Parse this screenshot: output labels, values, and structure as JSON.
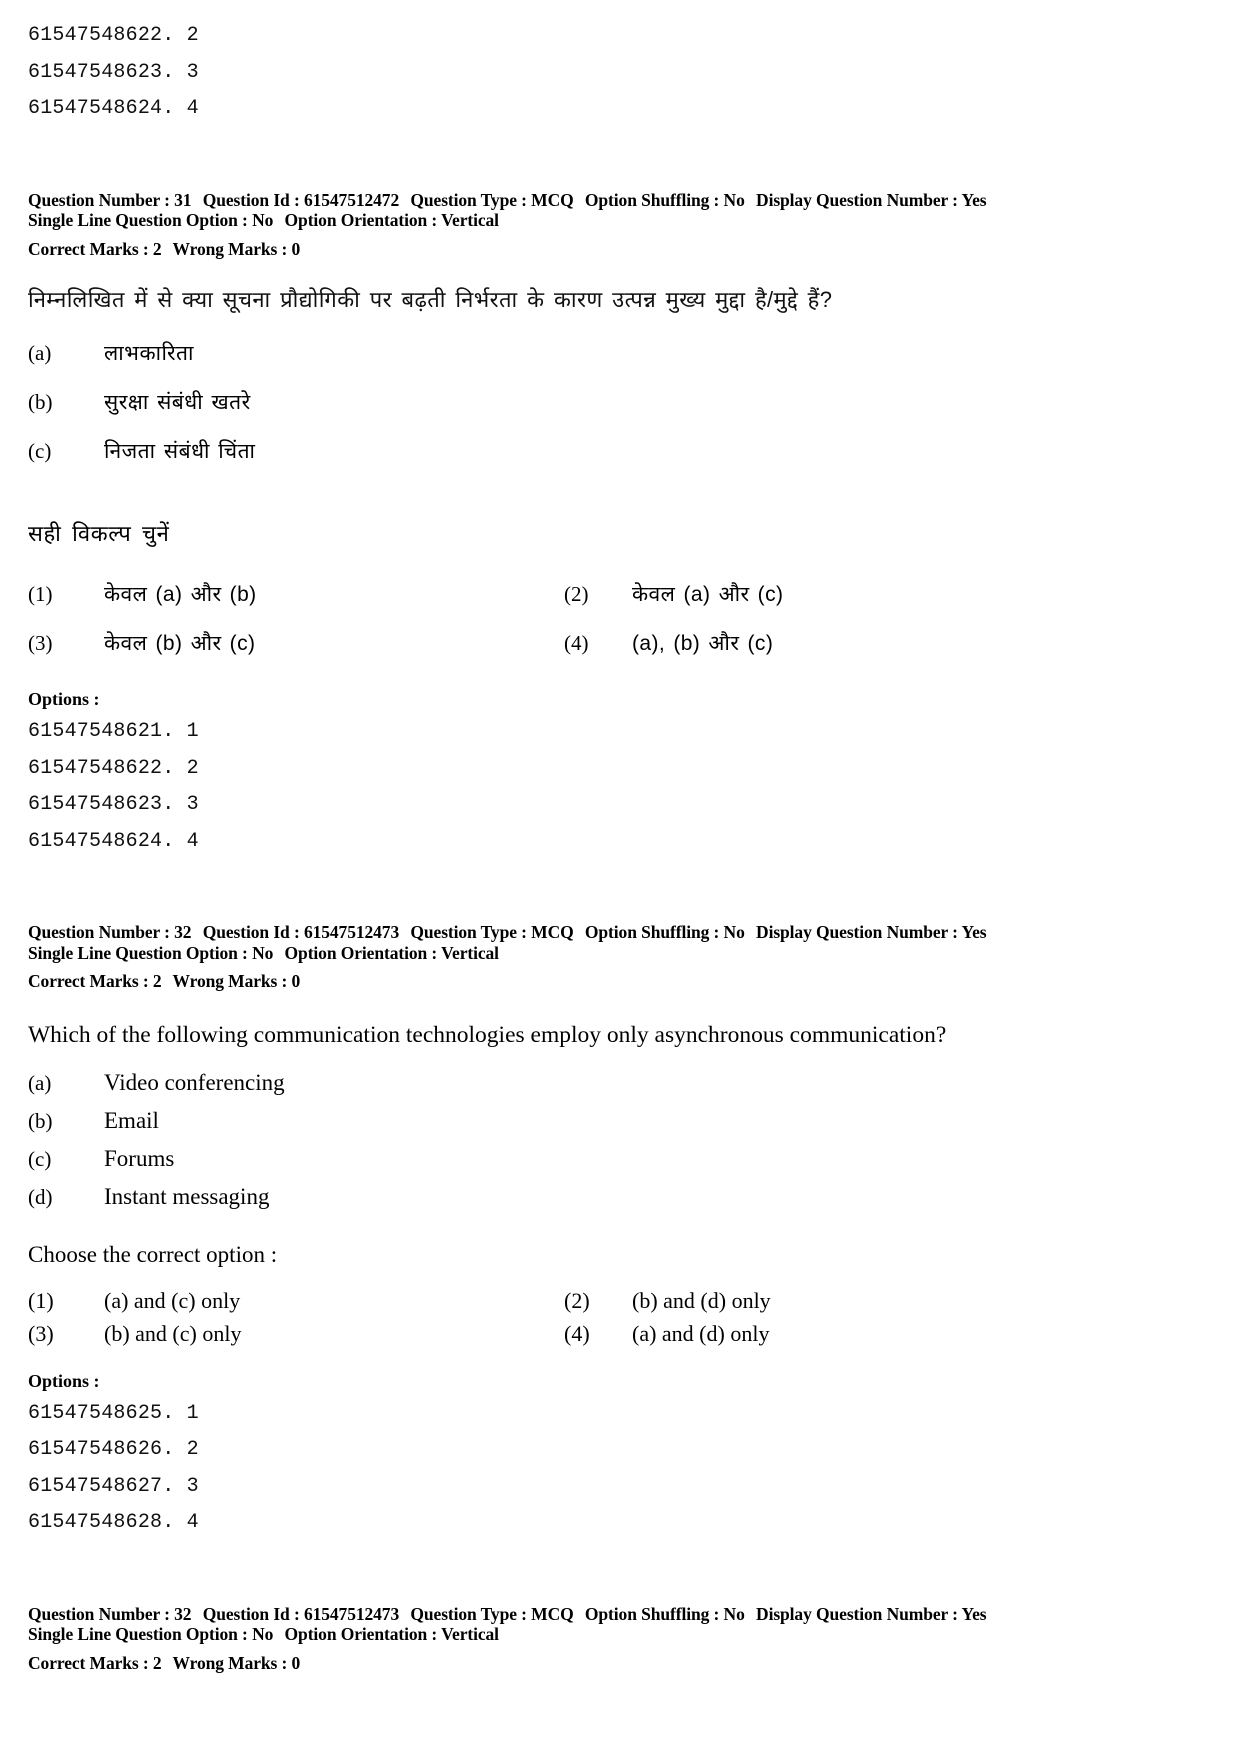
{
  "page": {
    "top_option_ids": [
      "61547548622. 2",
      "61547548623. 3",
      "61547548624. 4"
    ]
  },
  "question_31": {
    "meta": {
      "question_number_label": "Question Number :",
      "question_number": "31",
      "question_id_label": "Question Id :",
      "question_id": "61547512472",
      "question_type_label": "Question Type :",
      "question_type": "MCQ",
      "option_shuffling_label": "Option Shuffling :",
      "option_shuffling": "No",
      "display_question_number_label": "Display Question Number :",
      "display_question_number": "Yes",
      "single_line_question_option_label": "Single Line Question Option :",
      "single_line_question_option": "No",
      "option_orientation_label": "Option Orientation :",
      "option_orientation": "Vertical",
      "correct_marks_label": "Correct Marks :",
      "correct_marks": "2",
      "wrong_marks_label": "Wrong Marks :",
      "wrong_marks": "0"
    },
    "stem": "निम्नलिखित में से क्या सूचना प्रौद्योगिकी पर बढ़ती निर्भरता के कारण उत्पन्न मुख्य मुद्दा है/मुद्दे हैं?",
    "sub_options": [
      {
        "label": "(a)",
        "text": "लाभकारिता"
      },
      {
        "label": "(b)",
        "text": "सुरक्षा संबंधी खतरे"
      },
      {
        "label": "(c)",
        "text": "निजता संबंधी चिंता"
      }
    ],
    "choose_instruction": "सही विकल्प चुनें",
    "choices": [
      {
        "num": "(1)",
        "text": "केवल (a) और (b)"
      },
      {
        "num": "(2)",
        "text": "केवल (a) और (c)"
      },
      {
        "num": "(3)",
        "text": "केवल (b) और (c)"
      },
      {
        "num": "(4)",
        "text": "(a), (b) और (c)"
      }
    ],
    "options_label": "Options :",
    "option_ids": [
      "61547548621. 1",
      "61547548622. 2",
      "61547548623. 3",
      "61547548624. 4"
    ]
  },
  "question_32": {
    "meta": {
      "question_number_label": "Question Number :",
      "question_number": "32",
      "question_id_label": "Question Id :",
      "question_id": "61547512473",
      "question_type_label": "Question Type :",
      "question_type": "MCQ",
      "option_shuffling_label": "Option Shuffling :",
      "option_shuffling": "No",
      "display_question_number_label": "Display Question Number :",
      "display_question_number": "Yes",
      "single_line_question_option_label": "Single Line Question Option :",
      "single_line_question_option": "No",
      "option_orientation_label": "Option Orientation :",
      "option_orientation": "Vertical",
      "correct_marks_label": "Correct Marks :",
      "correct_marks": "2",
      "wrong_marks_label": "Wrong Marks :",
      "wrong_marks": "0"
    },
    "stem": "Which of the following communication technologies employ only asynchronous communication?",
    "sub_options": [
      {
        "label": "(a)",
        "text": "Video conferencing"
      },
      {
        "label": "(b)",
        "text": "Email"
      },
      {
        "label": "(c)",
        "text": "Forums"
      },
      {
        "label": "(d)",
        "text": "Instant messaging"
      }
    ],
    "choose_instruction": "Choose the correct option :",
    "choices": [
      {
        "num": "(1)",
        "text": "(a) and (c) only"
      },
      {
        "num": "(2)",
        "text": "(b) and (d) only"
      },
      {
        "num": "(3)",
        "text": "(b) and (c) only"
      },
      {
        "num": "(4)",
        "text": "(a) and (d) only"
      }
    ],
    "options_label": "Options :",
    "option_ids": [
      "61547548625. 1",
      "61547548626. 2",
      "61547548627. 3",
      "61547548628. 4"
    ]
  },
  "question_32_repeat": {
    "meta": {
      "question_number_label": "Question Number :",
      "question_number": "32",
      "question_id_label": "Question Id :",
      "question_id": "61547512473",
      "question_type_label": "Question Type :",
      "question_type": "MCQ",
      "option_shuffling_label": "Option Shuffling :",
      "option_shuffling": "No",
      "display_question_number_label": "Display Question Number :",
      "display_question_number": "Yes",
      "single_line_question_option_label": "Single Line Question Option :",
      "single_line_question_option": "No",
      "option_orientation_label": "Option Orientation :",
      "option_orientation": "Vertical",
      "correct_marks_label": "Correct Marks :",
      "correct_marks": "2",
      "wrong_marks_label": "Wrong Marks :",
      "wrong_marks": "0"
    }
  }
}
